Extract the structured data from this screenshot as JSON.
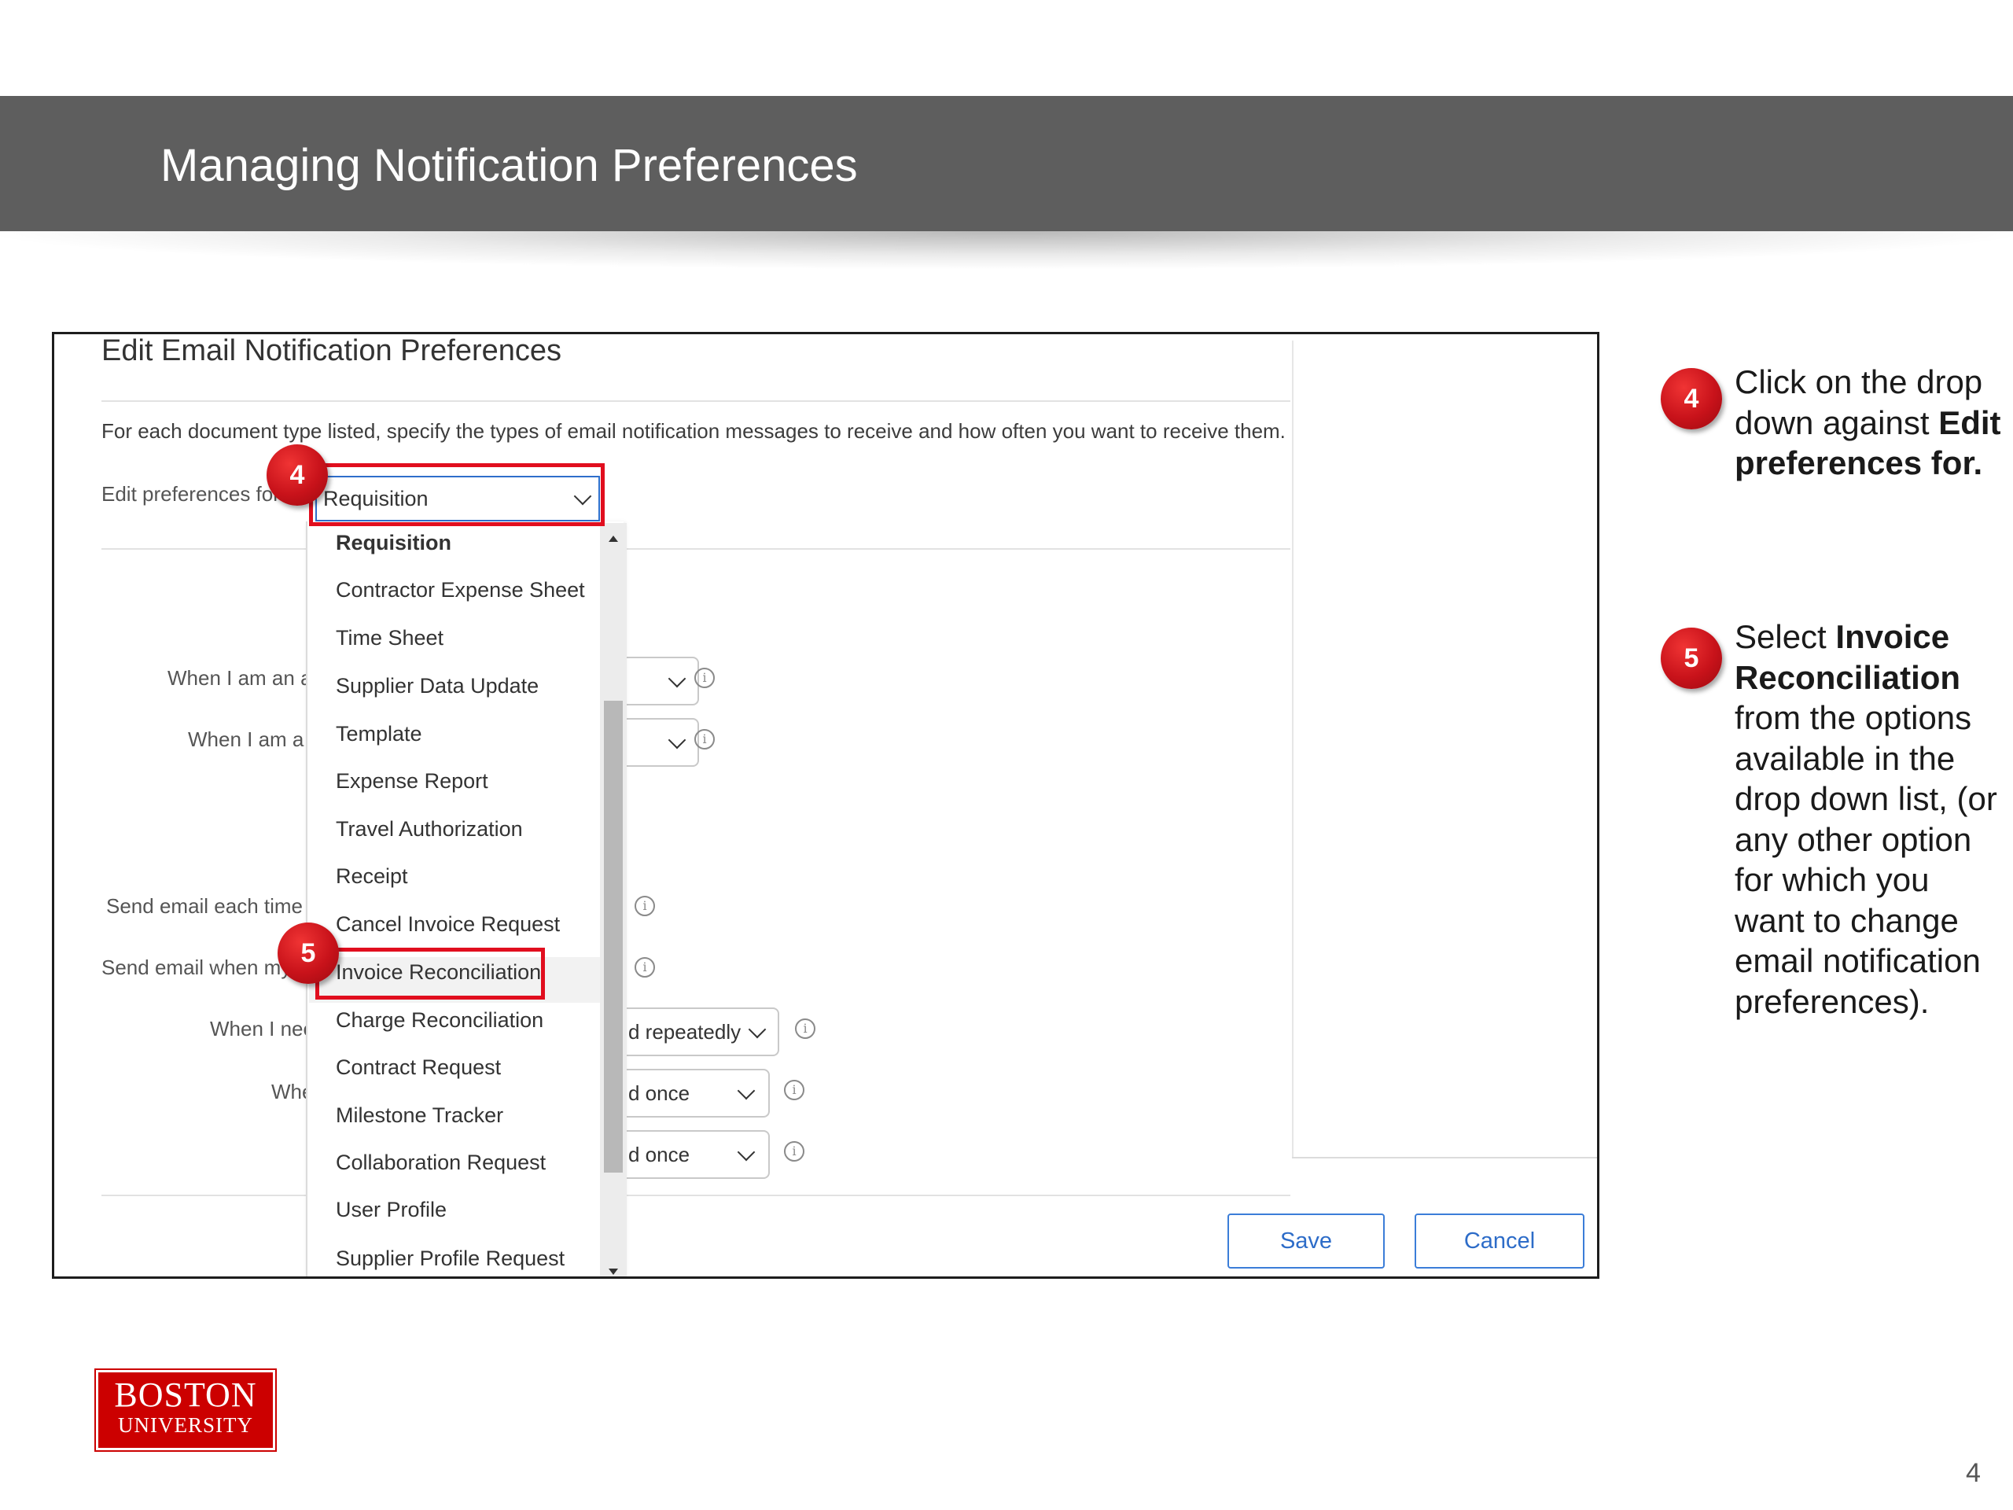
{
  "slide": {
    "title": "Managing Notification Preferences",
    "page_number": "4"
  },
  "dialog": {
    "title": "Edit Email Notification Preferences",
    "instructions": "For each document type listed, specify the types of email notification messages to receive and how often you want to receive them.",
    "edit_prefs_label": "Edit preferences for:",
    "selected_value": "Requisition",
    "background_labels": {
      "row1": "When I am an a",
      "row2": "When I am a",
      "row3": "Send email each time",
      "row4": "Send email when my",
      "row5": "When I nee",
      "row6": "Whe"
    },
    "background_selects": {
      "sel1": "",
      "sel2": "",
      "sel3": "d repeatedly",
      "sel4": "d once",
      "sel5": "d once"
    },
    "dropdown_options": [
      "Requisition",
      "Contractor Expense Sheet",
      "Time Sheet",
      "Supplier Data Update",
      "Template",
      "Expense Report",
      "Travel Authorization",
      "Receipt",
      "Cancel Invoice Request",
      "Invoice Reconciliation",
      "Charge Reconciliation",
      "Contract Request",
      "Milestone Tracker",
      "Collaboration Request",
      "User Profile",
      "Supplier Profile Request"
    ],
    "save_label": "Save",
    "cancel_label": "Cancel"
  },
  "steps": {
    "step4_number": "4",
    "step5_number": "5"
  },
  "logo": {
    "line1": "BOSTON",
    "line2": "UNIVERSITY"
  },
  "colors": {
    "header_band": "#5e5e5e",
    "highlight_red": "#e10e1e",
    "badge_red": "#c8121a",
    "button_blue": "#2d6cc8",
    "logo_red": "#cc0000"
  }
}
